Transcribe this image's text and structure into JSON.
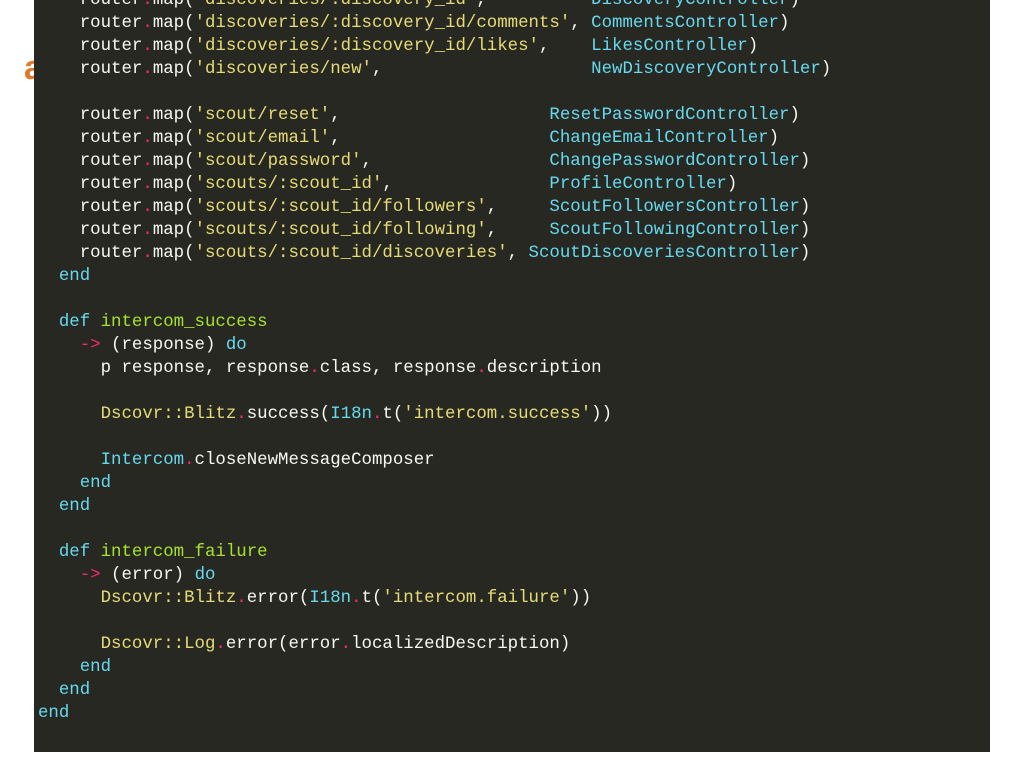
{
  "background_fragment": "a",
  "colors": {
    "panel_bg": "#272822",
    "default": "#f8f8f2",
    "operator": "#f92672",
    "string": "#e6db74",
    "constant": "#66d9ef",
    "keyword": "#66d9ef",
    "function": "#a6e22e",
    "class": "#e6db74"
  },
  "code": {
    "lines": [
      [
        [
          "default",
          "    router"
        ],
        [
          "op",
          "."
        ],
        [
          "default",
          "map("
        ],
        [
          "str",
          "'discoveries/:discovery_id'"
        ],
        [
          "default",
          ",          "
        ],
        [
          "const",
          "DiscoveryController"
        ],
        [
          "default",
          ")"
        ]
      ],
      [
        [
          "default",
          "    router"
        ],
        [
          "op",
          "."
        ],
        [
          "default",
          "map("
        ],
        [
          "str",
          "'discoveries/:discovery_id/comments'"
        ],
        [
          "default",
          ", "
        ],
        [
          "const",
          "CommentsController"
        ],
        [
          "default",
          ")"
        ]
      ],
      [
        [
          "default",
          "    router"
        ],
        [
          "op",
          "."
        ],
        [
          "default",
          "map("
        ],
        [
          "str",
          "'discoveries/:discovery_id/likes'"
        ],
        [
          "default",
          ",    "
        ],
        [
          "const",
          "LikesController"
        ],
        [
          "default",
          ")"
        ]
      ],
      [
        [
          "default",
          "    router"
        ],
        [
          "op",
          "."
        ],
        [
          "default",
          "map("
        ],
        [
          "str",
          "'discoveries/new'"
        ],
        [
          "default",
          ",                    "
        ],
        [
          "const",
          "NewDiscoveryController"
        ],
        [
          "default",
          ")"
        ]
      ],
      [],
      [
        [
          "default",
          "    router"
        ],
        [
          "op",
          "."
        ],
        [
          "default",
          "map("
        ],
        [
          "str",
          "'scout/reset'"
        ],
        [
          "default",
          ",                    "
        ],
        [
          "const",
          "ResetPasswordController"
        ],
        [
          "default",
          ")"
        ]
      ],
      [
        [
          "default",
          "    router"
        ],
        [
          "op",
          "."
        ],
        [
          "default",
          "map("
        ],
        [
          "str",
          "'scout/email'"
        ],
        [
          "default",
          ",                    "
        ],
        [
          "const",
          "ChangeEmailController"
        ],
        [
          "default",
          ")"
        ]
      ],
      [
        [
          "default",
          "    router"
        ],
        [
          "op",
          "."
        ],
        [
          "default",
          "map("
        ],
        [
          "str",
          "'scout/password'"
        ],
        [
          "default",
          ",                 "
        ],
        [
          "const",
          "ChangePasswordController"
        ],
        [
          "default",
          ")"
        ]
      ],
      [
        [
          "default",
          "    router"
        ],
        [
          "op",
          "."
        ],
        [
          "default",
          "map("
        ],
        [
          "str",
          "'scouts/:scout_id'"
        ],
        [
          "default",
          ",               "
        ],
        [
          "const",
          "ProfileController"
        ],
        [
          "default",
          ")"
        ]
      ],
      [
        [
          "default",
          "    router"
        ],
        [
          "op",
          "."
        ],
        [
          "default",
          "map("
        ],
        [
          "str",
          "'scouts/:scout_id/followers'"
        ],
        [
          "default",
          ",     "
        ],
        [
          "const",
          "ScoutFollowersController"
        ],
        [
          "default",
          ")"
        ]
      ],
      [
        [
          "default",
          "    router"
        ],
        [
          "op",
          "."
        ],
        [
          "default",
          "map("
        ],
        [
          "str",
          "'scouts/:scout_id/following'"
        ],
        [
          "default",
          ",     "
        ],
        [
          "const",
          "ScoutFollowingController"
        ],
        [
          "default",
          ")"
        ]
      ],
      [
        [
          "default",
          "    router"
        ],
        [
          "op",
          "."
        ],
        [
          "default",
          "map("
        ],
        [
          "str",
          "'scouts/:scout_id/discoveries'"
        ],
        [
          "default",
          ", "
        ],
        [
          "const",
          "ScoutDiscoveriesController"
        ],
        [
          "default",
          ")"
        ]
      ],
      [
        [
          "kw",
          "  end"
        ]
      ],
      [],
      [
        [
          "kw",
          "  def "
        ],
        [
          "fn",
          "intercom_success"
        ]
      ],
      [
        [
          "op",
          "    ->"
        ],
        [
          "default",
          " (response) "
        ],
        [
          "kw",
          "do"
        ]
      ],
      [
        [
          "default",
          "      p response, response"
        ],
        [
          "op",
          "."
        ],
        [
          "default",
          "class, response"
        ],
        [
          "op",
          "."
        ],
        [
          "default",
          "description"
        ]
      ],
      [],
      [
        [
          "cls",
          "      Dscovr::Blitz"
        ],
        [
          "op",
          "."
        ],
        [
          "default",
          "success("
        ],
        [
          "const",
          "I18n"
        ],
        [
          "op",
          "."
        ],
        [
          "default",
          "t("
        ],
        [
          "str",
          "'intercom.success'"
        ],
        [
          "default",
          "))"
        ]
      ],
      [],
      [
        [
          "const",
          "      Intercom"
        ],
        [
          "op",
          "."
        ],
        [
          "default",
          "closeNewMessageComposer"
        ]
      ],
      [
        [
          "kw",
          "    end"
        ]
      ],
      [
        [
          "kw",
          "  end"
        ]
      ],
      [],
      [
        [
          "kw",
          "  def "
        ],
        [
          "fn",
          "intercom_failure"
        ]
      ],
      [
        [
          "op",
          "    ->"
        ],
        [
          "default",
          " (error) "
        ],
        [
          "kw",
          "do"
        ]
      ],
      [
        [
          "cls",
          "      Dscovr::Blitz"
        ],
        [
          "op",
          "."
        ],
        [
          "default",
          "error("
        ],
        [
          "const",
          "I18n"
        ],
        [
          "op",
          "."
        ],
        [
          "default",
          "t("
        ],
        [
          "str",
          "'intercom.failure'"
        ],
        [
          "default",
          "))"
        ]
      ],
      [],
      [
        [
          "cls",
          "      Dscovr::Log"
        ],
        [
          "op",
          "."
        ],
        [
          "default",
          "error(error"
        ],
        [
          "op",
          "."
        ],
        [
          "default",
          "localizedDescription)"
        ]
      ],
      [
        [
          "kw",
          "    end"
        ]
      ],
      [
        [
          "kw",
          "  end"
        ]
      ],
      [
        [
          "kw",
          "end"
        ]
      ]
    ]
  }
}
